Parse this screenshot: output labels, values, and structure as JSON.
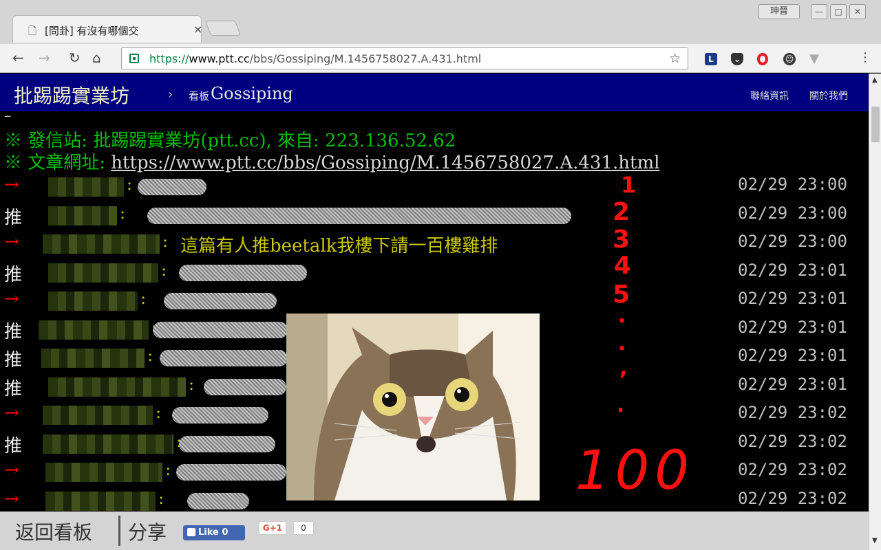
{
  "browser": {
    "tab_title": "[問卦] 有沒有哪個交",
    "tab_close": "×",
    "profile_name": "珅晉",
    "url_scheme": "https://",
    "url_host": "www.ptt.cc",
    "url_path": "/bbs/Gossiping/M.1456758027.A.431.html",
    "icons": [
      "page-icon",
      "back-icon",
      "forward-icon",
      "reload-icon",
      "home-icon",
      "lock-icon",
      "star-icon",
      "menu-icon"
    ]
  },
  "header": {
    "site_title": "批踢踢實業坊",
    "crumb_arrow": "›",
    "crumb_label": "看板",
    "board_name": "Gossiping",
    "contact": "聯絡資訊",
    "about": "關於我們"
  },
  "signature": {
    "dash": "--",
    "line1": "※ 發信站: 批踢踢實業坊(ptt.cc), 來自: 223.136.52.62",
    "line2_prefix": "※ 文章網址: ",
    "line2_link": "https://www.ptt.cc/bbs/Gossiping/M.1456758027.A.431.html"
  },
  "pushes": [
    {
      "tag": "→",
      "text": "",
      "time": "02/29 23:00"
    },
    {
      "tag": "推",
      "text": "",
      "time": "02/29 23:00"
    },
    {
      "tag": "→",
      "text": "這篇有人推beetalk我樓下請一百樓雞排",
      "time": "02/29 23:00"
    },
    {
      "tag": "推",
      "text": "",
      "time": "02/29 23:01"
    },
    {
      "tag": "→",
      "text": "",
      "time": "02/29 23:01"
    },
    {
      "tag": "推",
      "text": "",
      "time": "02/29 23:01"
    },
    {
      "tag": "推",
      "text": "",
      "time": "02/29 23:01"
    },
    {
      "tag": "推",
      "text": "",
      "time": "02/29 23:01"
    },
    {
      "tag": "→",
      "text": "",
      "time": "02/29 23:02"
    },
    {
      "tag": "推",
      "text": "",
      "time": "02/29 23:02"
    },
    {
      "tag": "→",
      "text": "",
      "time": "02/29 23:02"
    },
    {
      "tag": "→",
      "text": "",
      "time": "02/29 23:02"
    }
  ],
  "annotations": {
    "numbers": [
      "1",
      "2",
      "3",
      "4",
      "5"
    ],
    "dots": [
      ".",
      ".",
      ",",
      "."
    ],
    "final": "100",
    "color": "#ff1010"
  },
  "footer": {
    "back_to_board": "返回看板",
    "share": "分享",
    "fb_like": "Like 0",
    "gplus": "G+1",
    "gplus_count": "0"
  },
  "colors": {
    "header_bg": "#000080",
    "push_text": "#c8c800",
    "signature": "#00c000"
  }
}
